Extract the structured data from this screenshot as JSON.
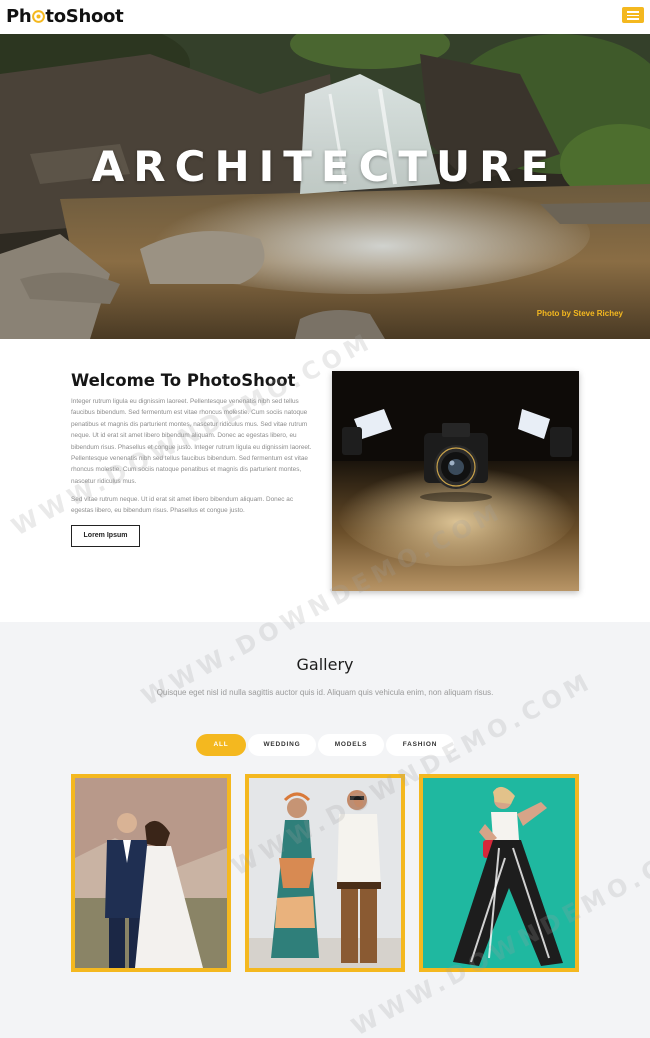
{
  "brand": {
    "logo_text_left": "Ph",
    "logo_text_right": "toShoot",
    "accent": "#f4b81f"
  },
  "header": {
    "menu_icon": "hamburger-icon"
  },
  "hero": {
    "title": "ARCHITECTURE",
    "credit": "Photo by Steve Richey"
  },
  "about": {
    "title": "Welcome To PhotoShoot",
    "paragraph1": "Integer rutrum ligula eu dignissim laoreet. Pellentesque venenatis nibh sed tellus faucibus bibendum. Sed fermentum est vitae rhoncus molestie. Cum sociis natoque penatibus et magnis dis parturient montes, nascetur ridiculus mus. Sed vitae rutrum neque. Ut id erat sit amet libero bibendum aliquam. Donec ac egestas libero, eu bibendum risus. Phasellus et congue justo. Integer rutrum ligula eu dignissim laoreet. Pellentesque venenatis nibh sed tellus faucibus bibendum. Sed fermentum est vitae rhoncus molestie. Cum sociis natoque penatibus et magnis dis parturient montes, nascetur ridiculus mus.",
    "paragraph2": "Sed vitae rutrum neque. Ut id erat sit amet libero bibendum aliquam. Donec ac egestas libero, eu bibendum risus. Phasellus et congue justo.",
    "button_label": "Lorem Ipsum"
  },
  "gallery": {
    "title": "Gallery",
    "subtitle": "Quisque eget nisl id nulla sagittis auctor quis id. Aliquam quis vehicula enim, non aliquam risus.",
    "filters": [
      {
        "label": "ALL",
        "active": true
      },
      {
        "label": "WEDDING",
        "active": false
      },
      {
        "label": "MODELS",
        "active": false
      },
      {
        "label": "FASHION",
        "active": false
      }
    ]
  },
  "watermark": "WWW.DOWNDEMO.COM"
}
